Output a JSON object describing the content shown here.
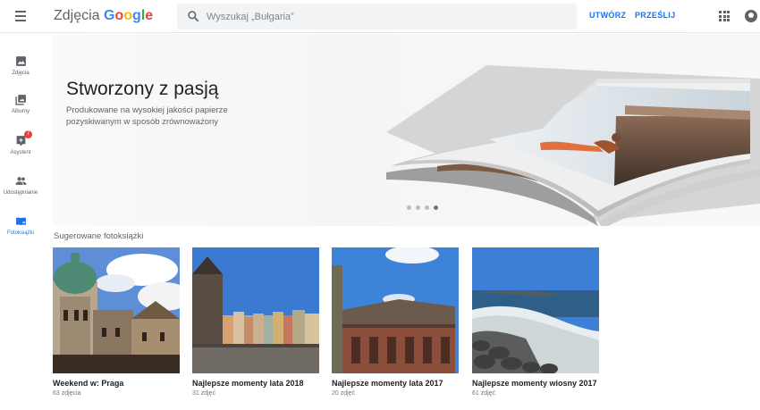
{
  "header": {
    "app_name": "Zdjęcia",
    "brand_letters": [
      "G",
      "o",
      "o",
      "g",
      "l",
      "e"
    ],
    "search_placeholder": "Wyszukaj „Bułgaria”",
    "create_label": "UTWÓRZ",
    "upload_label": "PRZEŚLIJ",
    "icons": [
      "menu-icon",
      "search-icon",
      "apps-grid-icon",
      "account-icon"
    ]
  },
  "sidebar": {
    "items": [
      {
        "label": "Zdjęcia",
        "icon": "photo-icon"
      },
      {
        "label": "Albumy",
        "icon": "albums-icon"
      },
      {
        "label": "Asystent",
        "icon": "assistant-icon",
        "badge": "7"
      },
      {
        "label": "Udostępnianie",
        "icon": "people-icon"
      },
      {
        "label": "Fotoksiążki",
        "icon": "photobook-icon",
        "active": true
      }
    ]
  },
  "banner": {
    "title": "Stworzony z pasją",
    "description": "Produkowane na wysokiej jakości papierze pozyskiwanym w sposób zrównoważony",
    "slides": 4,
    "active_slide": 4
  },
  "suggested": {
    "title": "Sugerowane fotoksiążki",
    "books": [
      {
        "title": "Weekend w: Praga",
        "count": "63 zdjęcia"
      },
      {
        "title": "Najlepsze momenty lata 2018",
        "count": "31 zdjęć"
      },
      {
        "title": "Najlepsze momenty lata 2017",
        "count": "20 zdjęć"
      },
      {
        "title": "Najlepsze momenty wiosny 2017",
        "count": "61 zdjęć"
      }
    ]
  },
  "colors": {
    "accent": "#1a73e8",
    "badge": "#ea4335",
    "icon": "#5f6368",
    "google_blue": "#4285f4",
    "google_red": "#ea4335",
    "google_yellow": "#fbbc05",
    "google_green": "#34a853"
  }
}
